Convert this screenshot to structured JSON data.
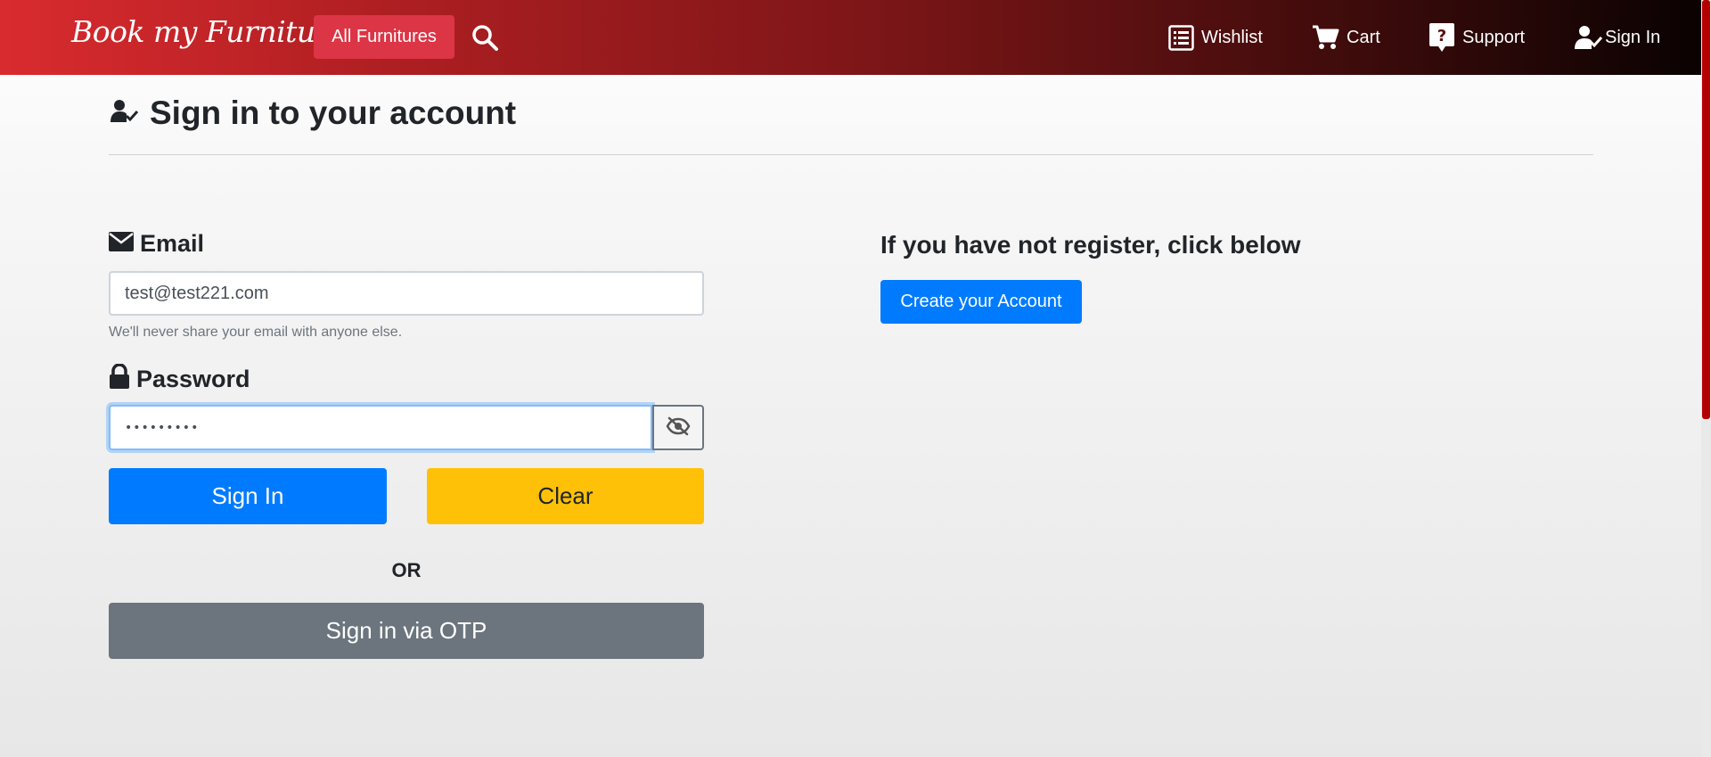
{
  "navbar": {
    "brand": "Book my Furniture",
    "all_furnitures_label": "All Furnitures",
    "items": [
      {
        "label": "Wishlist",
        "icon": "list-alt-icon"
      },
      {
        "label": "Cart",
        "icon": "cart-icon"
      },
      {
        "label": "Support",
        "icon": "question-icon"
      },
      {
        "label": "Sign In",
        "icon": "user-check-icon"
      }
    ],
    "background_start": "#d92b2f",
    "background_end": "#0a0202"
  },
  "page": {
    "title": "Sign in to your account",
    "title_icon": "user-check-icon"
  },
  "form": {
    "email_label": "Email",
    "email_value": "test@test221.com",
    "email_help": "We'll never share your email with anyone else.",
    "password_label": "Password",
    "password_value": "•••••••••",
    "toggle_icon": "eye-slash-icon",
    "signin_label": "Sign In",
    "clear_label": "Clear",
    "or_text": "OR",
    "otp_label": "Sign in via OTP"
  },
  "register": {
    "heading": "If you have not register, click below",
    "button_label": "Create your Account"
  },
  "colors": {
    "primary": "#007bff",
    "warning": "#ffc107",
    "secondary": "#6c757d",
    "danger": "#dc3545"
  }
}
